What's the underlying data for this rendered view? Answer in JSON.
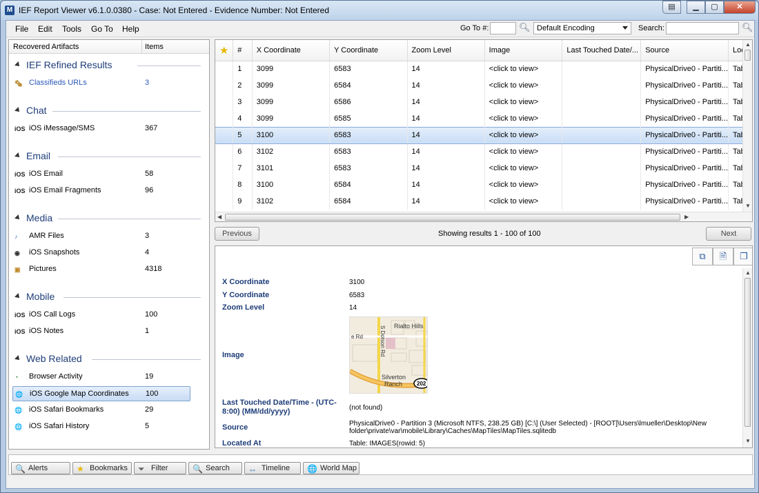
{
  "window": {
    "title": "IEF Report Viewer v6.1.0.0380 - Case: Not Entered - Evidence Number: Not Entered",
    "app_icon": "M"
  },
  "menu": [
    "File",
    "Edit",
    "Tools",
    "Go To",
    "Help"
  ],
  "toolbar": {
    "goto_label": "Go To #:",
    "goto_value": "",
    "encoding": "Default Encoding",
    "search_label": "Search:",
    "search_value": ""
  },
  "left_panel": {
    "header_name": "Recovered Artifacts",
    "header_items": "Items",
    "groups": [
      {
        "title": "IEF Refined Results",
        "items": [
          {
            "label": "Classifieds URLs",
            "count": "3",
            "icon": "classifieds-icon"
          }
        ]
      },
      {
        "title": "Chat",
        "items": [
          {
            "label": "iOS iMessage/SMS",
            "count": "367",
            "icon": "ios-icon"
          }
        ]
      },
      {
        "title": "Email",
        "items": [
          {
            "label": "iOS Email",
            "count": "58",
            "icon": "ios-icon"
          },
          {
            "label": "iOS Email Fragments",
            "count": "96",
            "icon": "ios-icon"
          }
        ]
      },
      {
        "title": "Media",
        "items": [
          {
            "label": "AMR Files",
            "count": "3",
            "icon": "audio-icon"
          },
          {
            "label": "iOS Snapshots",
            "count": "4",
            "icon": "camera-icon"
          },
          {
            "label": "Pictures",
            "count": "4318",
            "icon": "pictures-icon"
          }
        ]
      },
      {
        "title": "Mobile",
        "items": [
          {
            "label": "iOS Call Logs",
            "count": "100",
            "icon": "ios-icon"
          },
          {
            "label": "iOS Notes",
            "count": "1",
            "icon": "ios-icon"
          }
        ]
      },
      {
        "title": "Web Related",
        "items": [
          {
            "label": "Browser Activity",
            "count": "19",
            "icon": "browser-icon"
          },
          {
            "label": "iOS Google Map Coordinates",
            "count": "100",
            "icon": "globe-icon"
          },
          {
            "label": "iOS Safari Bookmarks",
            "count": "29",
            "icon": "globe-icon"
          },
          {
            "label": "iOS Safari History",
            "count": "5",
            "icon": "globe-icon"
          }
        ]
      }
    ]
  },
  "grid": {
    "columns": [
      "#",
      "X Coordinate",
      "Y Coordinate",
      "Zoom Level",
      "Image",
      "Last Touched Date/...",
      "Source",
      "Locat"
    ],
    "rows": [
      [
        "1",
        "3099",
        "6583",
        "14",
        "<click to view>",
        "",
        "PhysicalDrive0 - Partiti...",
        "Table"
      ],
      [
        "2",
        "3099",
        "6584",
        "14",
        "<click to view>",
        "",
        "PhysicalDrive0 - Partiti...",
        "Table"
      ],
      [
        "3",
        "3099",
        "6586",
        "14",
        "<click to view>",
        "",
        "PhysicalDrive0 - Partiti...",
        "Table"
      ],
      [
        "4",
        "3099",
        "6585",
        "14",
        "<click to view>",
        "",
        "PhysicalDrive0 - Partiti...",
        "Table"
      ],
      [
        "5",
        "3100",
        "6583",
        "14",
        "<click to view>",
        "",
        "PhysicalDrive0 - Partiti...",
        "Table"
      ],
      [
        "6",
        "3102",
        "6583",
        "14",
        "<click to view>",
        "",
        "PhysicalDrive0 - Partiti...",
        "Table"
      ],
      [
        "7",
        "3101",
        "6583",
        "14",
        "<click to view>",
        "",
        "PhysicalDrive0 - Partiti...",
        "Table"
      ],
      [
        "8",
        "3100",
        "6584",
        "14",
        "<click to view>",
        "",
        "PhysicalDrive0 - Partiti...",
        "Table"
      ],
      [
        "9",
        "3102",
        "6584",
        "14",
        "<click to view>",
        "",
        "PhysicalDrive0 - Partiti...",
        "Table"
      ]
    ]
  },
  "pager": {
    "previous": "Previous",
    "next": "Next",
    "showing": "Showing results 1 - 100 of 100"
  },
  "detail": {
    "x_label": "X Coordinate",
    "x_value": "3100",
    "y_label": "Y Coordinate",
    "y_value": "6583",
    "zoom_label": "Zoom Level",
    "zoom_value": "14",
    "image_label": "Image",
    "last_label_1": "Last Touched Date/Time - (UTC-",
    "last_label_2": "8:00) (MM/dd/yyyy)",
    "last_value": "(not found)",
    "source_label": "Source",
    "source_value_1": "PhysicalDrive0 - Partition 3 (Microsoft NTFS, 238.25 GB) [C:\\] (User Selected) - [ROOT]\\Users\\lmueller\\Desktop\\New",
    "source_value_2": "folder\\private\\var\\mobile\\Library\\Caches\\MapTiles\\MapTiles.sqlitedb",
    "located_label": "Located At",
    "located_value": "Table: IMAGES(rowid: 5)",
    "map": {
      "l1": "Rialto Hills",
      "l2": "S Dotson Rd",
      "l3": "e Rd",
      "l4": "Silverton",
      "l5": "Ranch",
      "l6": "202"
    }
  },
  "bottom_buttons": [
    {
      "label": "Alerts",
      "icon": "alerts-icon"
    },
    {
      "label": "Bookmarks",
      "icon": "star-icon"
    },
    {
      "label": "Filter",
      "icon": "filter-icon"
    },
    {
      "label": "Search",
      "icon": "search-icon"
    },
    {
      "label": "Timeline",
      "icon": "timeline-icon"
    },
    {
      "label": "World Map",
      "icon": "globe-icon"
    }
  ],
  "colors": {
    "accent": "#1e3d78",
    "selection": "#c9ddf5",
    "link": "#2a57b8"
  }
}
